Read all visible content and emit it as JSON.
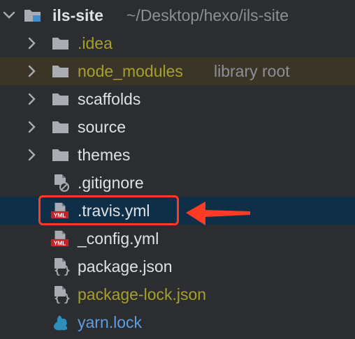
{
  "root": {
    "name": "ils-site",
    "path": "~/Desktop/hexo/ils-site"
  },
  "items": [
    {
      "label": ".idea",
      "suffix": "",
      "kind": "folder",
      "color": "olive"
    },
    {
      "label": "node_modules",
      "suffix": "library root",
      "kind": "folder",
      "color": "olive"
    },
    {
      "label": "scaffolds",
      "suffix": "",
      "kind": "folder",
      "color": "plain"
    },
    {
      "label": "source",
      "suffix": "",
      "kind": "folder",
      "color": "plain"
    },
    {
      "label": "themes",
      "suffix": "",
      "kind": "folder",
      "color": "plain"
    },
    {
      "label": ".gitignore",
      "suffix": "",
      "kind": "file-ignore",
      "color": "plain"
    },
    {
      "label": ".travis.yml",
      "suffix": "",
      "kind": "file-yml",
      "color": "plain",
      "selected": true
    },
    {
      "label": "_config.yml",
      "suffix": "",
      "kind": "file-yml",
      "color": "plain"
    },
    {
      "label": "package.json",
      "suffix": "",
      "kind": "file-json",
      "color": "plain"
    },
    {
      "label": "package-lock.json",
      "suffix": "",
      "kind": "file-json",
      "color": "olive"
    },
    {
      "label": "yarn.lock",
      "suffix": "",
      "kind": "file-yarn",
      "color": "blue"
    }
  ],
  "yml_badge": "YML",
  "colors": {
    "background": "#2b2d30",
    "selected_row": "#0e2f47",
    "excluded_row": "#3b3528",
    "text": "#dfe1e5",
    "olive_text": "#a8a029",
    "muted_text": "#8c8f95",
    "blue_text": "#5c9fe0",
    "annotation": "#ff3b26"
  },
  "icons": {
    "expand": "chevron-right-icon",
    "collapse": "chevron-down-icon",
    "folder": "folder-icon",
    "file_ignore": "gitignore-file-icon",
    "file_yml": "yml-file-icon",
    "file_json": "json-file-icon",
    "file_yarn": "yarn-icon"
  }
}
